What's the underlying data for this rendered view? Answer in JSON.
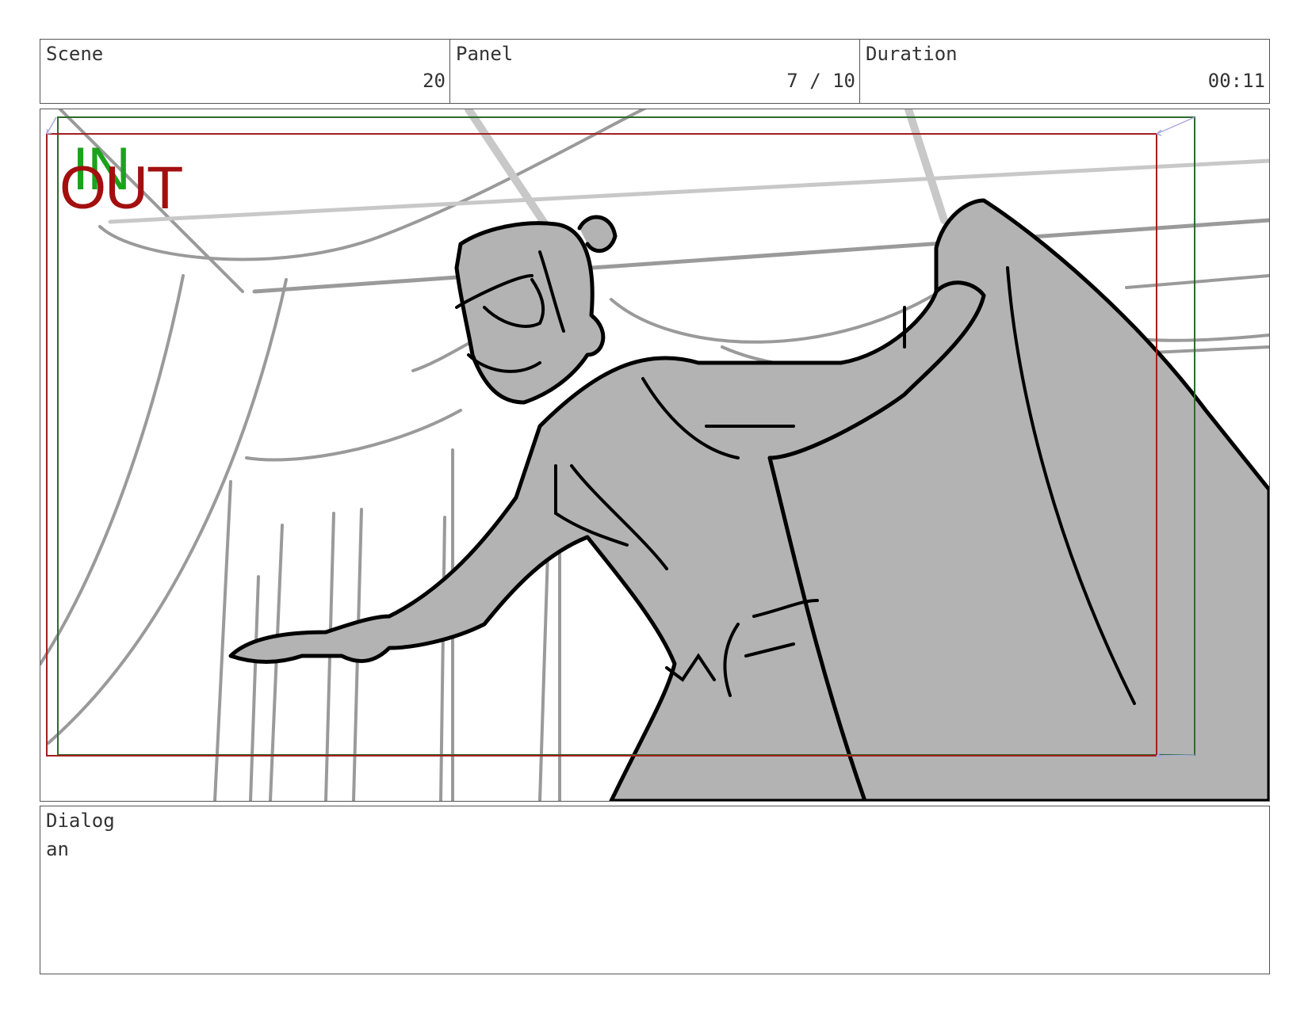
{
  "header": {
    "scene": {
      "label": "Scene",
      "value": "20"
    },
    "panel": {
      "label": "Panel",
      "value": "7 / 10"
    },
    "duration": {
      "label": "Duration",
      "value": "00:11"
    }
  },
  "frame": {
    "in_label": "IN",
    "out_label": "OUT",
    "colors": {
      "in": "#1aa31a",
      "out": "#a30f0f",
      "safe_frame_green": "#2f6b2f",
      "action_frame_red": "#a31f1f",
      "sketch_fill": "#b3b3b3",
      "sketch_line": "#000000",
      "background_line": "#999999"
    }
  },
  "dialog": {
    "label": "Dialog",
    "text": "an"
  }
}
